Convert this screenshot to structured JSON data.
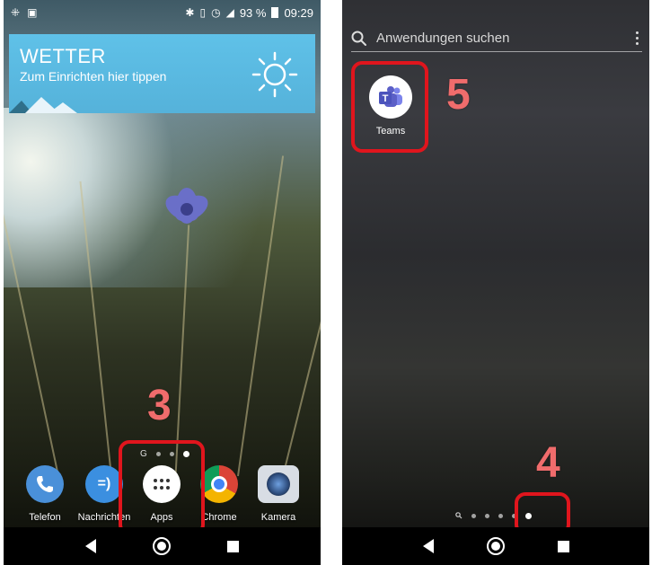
{
  "left_screen": {
    "status_bar": {
      "battery": "93 %",
      "time": "09:29",
      "icons": [
        "notification-icon",
        "image-icon",
        "bluetooth-icon",
        "vibrate-icon",
        "alarm-icon",
        "lte-signal-icon"
      ]
    },
    "weather_widget": {
      "title": "WETTER",
      "subtitle": "Zum Einrichten hier tippen",
      "icon": "sun-icon",
      "colors": {
        "background": "#5fc1e8"
      }
    },
    "dock": [
      {
        "label": "Telefon",
        "icon": "phone-icon",
        "color": "#4a90d9"
      },
      {
        "label": "Nachrichten",
        "icon": "messages-icon",
        "color": "#3b8fe0"
      },
      {
        "label": "Apps",
        "icon": "apps-grid-icon",
        "color": "#ffffff"
      },
      {
        "label": "Chrome",
        "icon": "chrome-icon",
        "color": "#db4437"
      },
      {
        "label": "Kamera",
        "icon": "camera-icon",
        "color": "#2c4a7a"
      }
    ],
    "page_indicator_google_letter": "G",
    "step_label": "3"
  },
  "right_screen": {
    "search": {
      "placeholder": "Anwendungen suchen"
    },
    "apps": [
      {
        "label": "Teams",
        "icon": "teams-icon",
        "color": "#5b5fc7"
      }
    ],
    "step_label_teams": "5",
    "step_label_dots": "4"
  },
  "colors": {
    "highlight": "#e0151d",
    "step_number": "#f06c6c"
  }
}
